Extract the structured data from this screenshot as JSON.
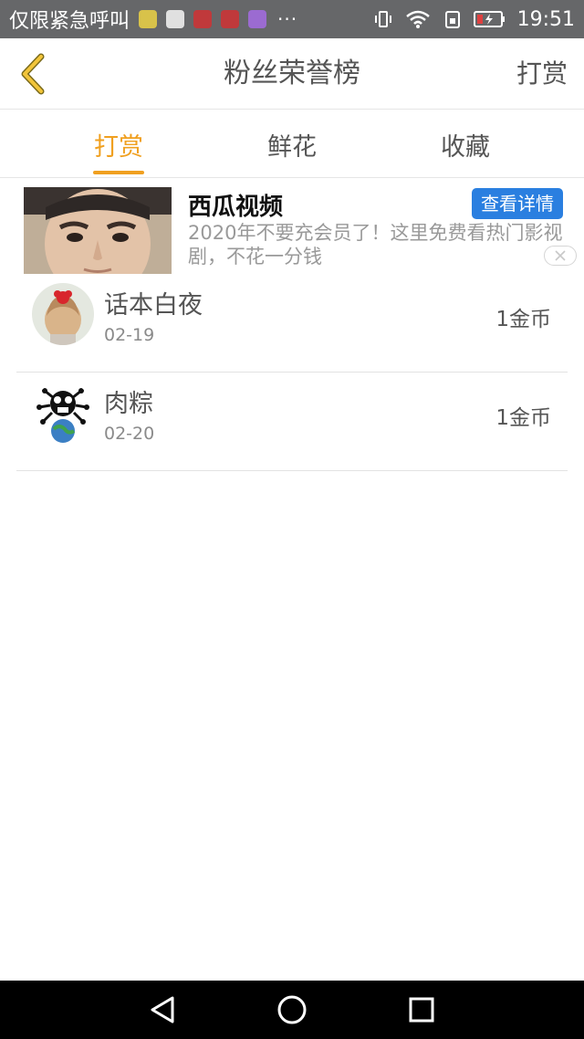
{
  "status_bar": {
    "notification_text": "仅限紧急呼叫",
    "dots": "···",
    "time": "19:51",
    "app_icons": [
      "wechat-icon",
      "font-icon",
      "video-app-icon",
      "book-app-icon",
      "gallery-icon"
    ],
    "app_icon_colors": [
      "#d8c24a",
      "#e0e0e0",
      "#c0393b",
      "#c0393b",
      "#9b6bd1"
    ]
  },
  "header": {
    "title": "粉丝荣誉榜",
    "action_label": "打赏",
    "back_icon": "chevron-left-icon",
    "accent_color": "#f0a020"
  },
  "tabs": [
    {
      "label": "打赏",
      "active": true
    },
    {
      "label": "鲜花",
      "active": false
    },
    {
      "label": "收藏",
      "active": false
    }
  ],
  "ad": {
    "title": "西瓜视频",
    "button_label": "查看详情",
    "description": "2020年不要充会员了！这里免费看热门影视剧，不花一分钱",
    "button_color": "#2a7fe0"
  },
  "list": [
    {
      "name": "话本白夜",
      "date": "02-19",
      "amount": "1金币"
    },
    {
      "name": "肉粽",
      "date": "02-20",
      "amount": "1金币"
    }
  ],
  "nav": {
    "icons": [
      "back-triangle-icon",
      "home-circle-icon",
      "recents-square-icon"
    ]
  }
}
